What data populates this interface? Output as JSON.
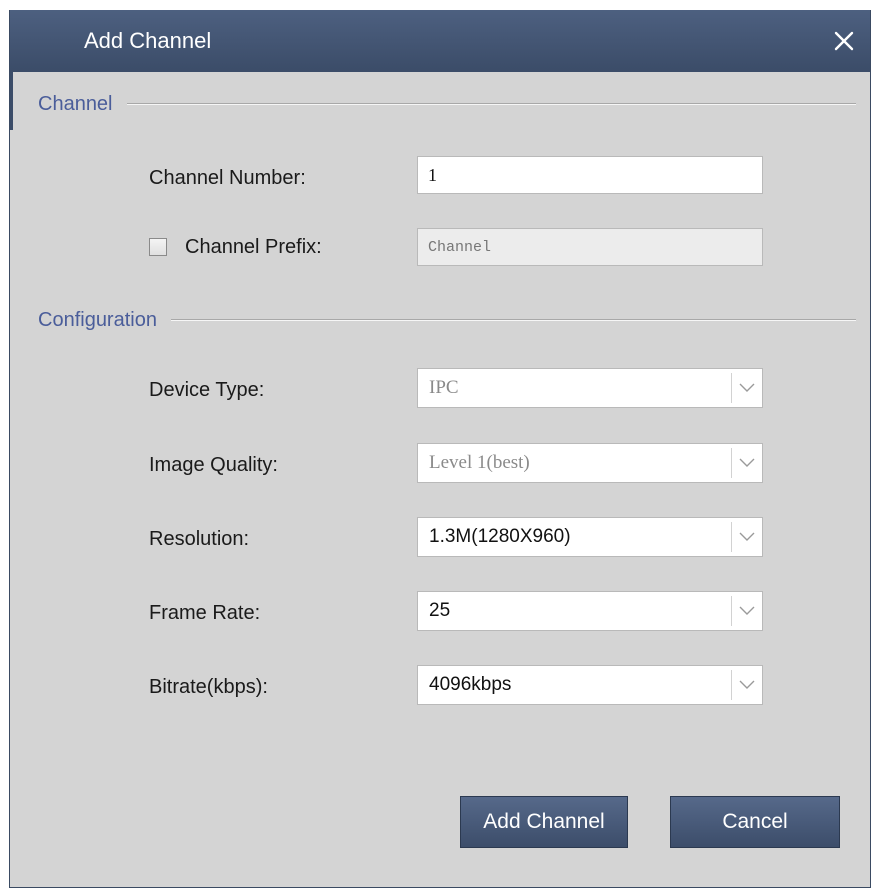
{
  "dialog": {
    "title": "Add Channel",
    "close_icon": "close-icon"
  },
  "sections": {
    "channel": "Channel",
    "configuration": "Configuration"
  },
  "fields": {
    "channel_number": {
      "label": "Channel Number:",
      "value": "1"
    },
    "channel_prefix": {
      "label": "Channel Prefix:",
      "value": "Channel",
      "checked": false,
      "disabled": true
    },
    "device_type": {
      "label": "Device Type:",
      "value": "IPC",
      "disabled": true
    },
    "image_quality": {
      "label": "Image Quality:",
      "value": "Level 1(best)",
      "disabled": true
    },
    "resolution": {
      "label": "Resolution:",
      "value": "1.3M(1280X960)"
    },
    "frame_rate": {
      "label": "Frame Rate:",
      "value": "25"
    },
    "bitrate": {
      "label": "Bitrate(kbps):",
      "value": "4096kbps"
    }
  },
  "buttons": {
    "add_channel": "Add Channel",
    "cancel": "Cancel"
  },
  "colors": {
    "title_bar": "#3b4c68",
    "section_label": "#4a5d9a",
    "dialog_background": "#d4d4d4"
  }
}
